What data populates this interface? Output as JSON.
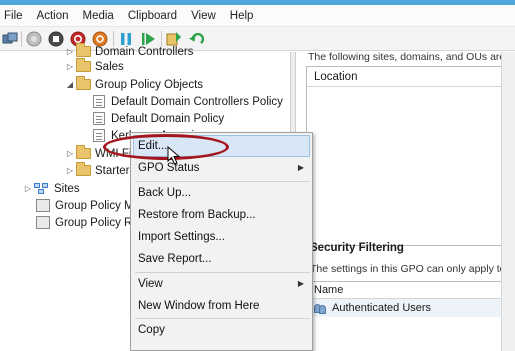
{
  "menu": [
    "File",
    "Action",
    "Media",
    "Clipboard",
    "View",
    "Help"
  ],
  "toolbar_icons": [
    "ctrl-alt-del-icon",
    "start-icon",
    "stop-icon",
    "shutdown-icon",
    "reset-icon",
    "pause-icon",
    "resume-icon",
    "checkpoint-icon",
    "revert-icon"
  ],
  "tree": {
    "top_item": "Domain Controllers",
    "sales": "Sales",
    "gpo_container": "Group Policy Objects",
    "gpo1": "Default Domain Controllers Policy",
    "gpo2": "Default Domain Policy",
    "gpo3": "Kerberos Armoring",
    "wmi": "WMI Filters",
    "starter": "Starter GPOs",
    "sites": "Sites",
    "gp_modeling": "Group Policy Modeling",
    "gp_results": "Group Policy Results"
  },
  "right": {
    "intro": "The following sites, domains, and OUs are",
    "location_header": "Location",
    "security_title": "Security Filtering",
    "security_text": "The settings in this GPO can only apply to",
    "name_header": "Name",
    "name_row": "Authenticated Users"
  },
  "context_menu": {
    "edit": "Edit...",
    "gpo_status": "GPO Status",
    "back_up": "Back Up...",
    "restore": "Restore from Backup...",
    "import": "Import Settings...",
    "save_report": "Save Report...",
    "view": "View",
    "new_window": "New Window from Here",
    "copy": "Copy"
  },
  "colors": {
    "annotation": "#a4161e",
    "highlight": "#d9e6f6",
    "title_bar": "#4fa7dd"
  }
}
